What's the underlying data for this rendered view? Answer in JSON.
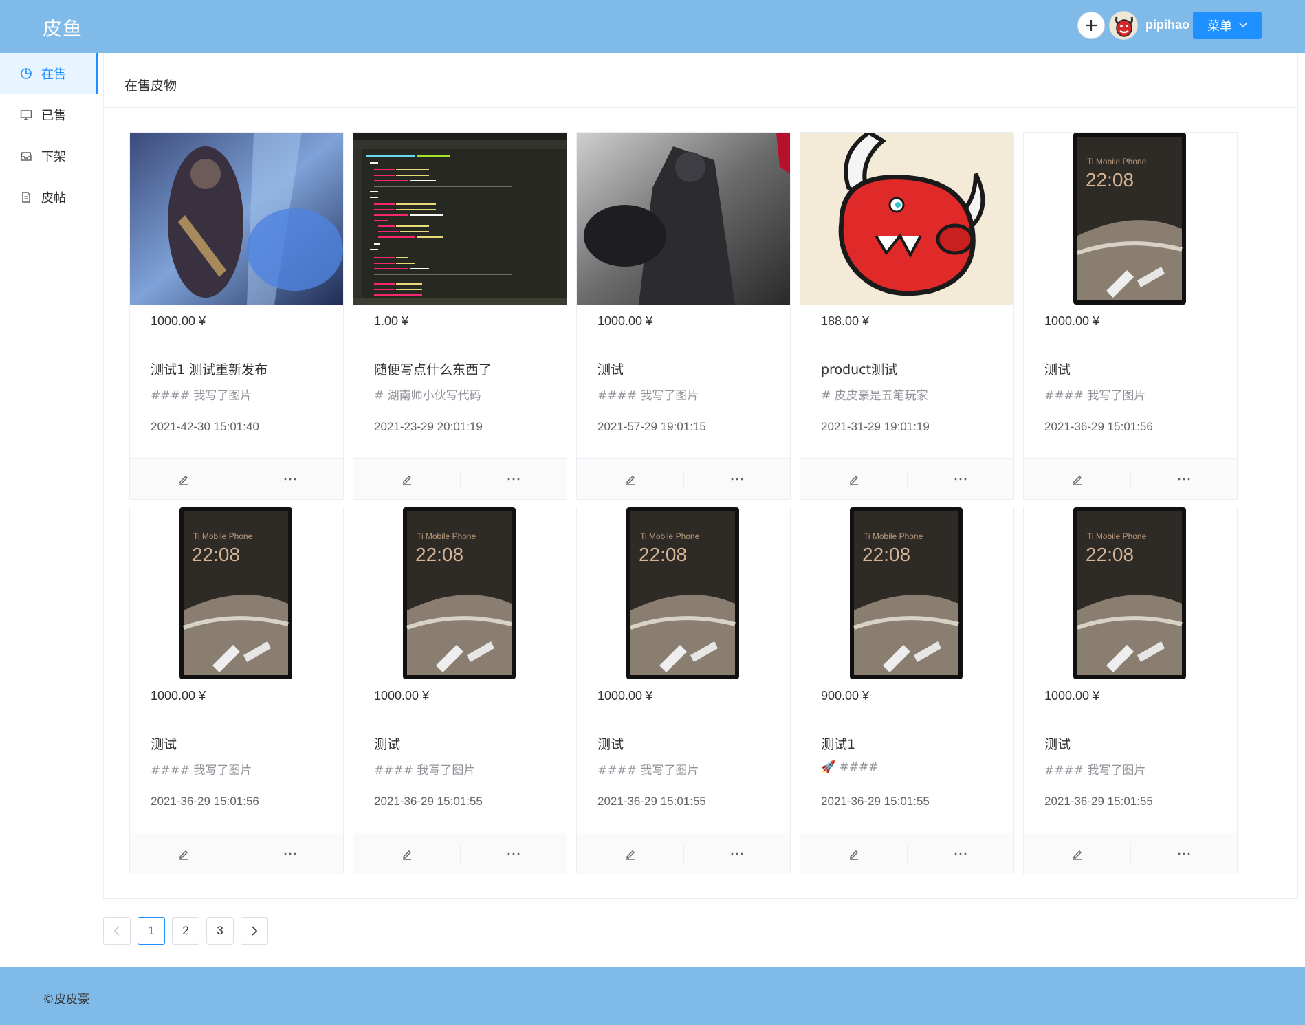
{
  "app": {
    "logo": "皮鱼"
  },
  "header": {
    "username": "pipihao",
    "menu_label": "菜单",
    "add_icon": "plus-icon",
    "avatar_icon": "bull-avatar"
  },
  "sidebar": {
    "items": [
      {
        "label": "在售",
        "icon": "pie-chart-icon",
        "active": true
      },
      {
        "label": "已售",
        "icon": "monitor-icon",
        "active": false
      },
      {
        "label": "下架",
        "icon": "inbox-icon",
        "active": false
      },
      {
        "label": "皮帖",
        "icon": "document-icon",
        "active": false
      }
    ]
  },
  "main": {
    "title": "在售皮物",
    "cards": [
      {
        "image": "game-warrior-blue",
        "price": "1000.00 ¥",
        "title": "测试1 测试重新发布",
        "desc": "#### 我写了图片",
        "time": "2021-42-30 15:01:40"
      },
      {
        "image": "code-editor",
        "price": "1.00 ¥",
        "title": "随便写点什么东西了",
        "desc": "# 湖南帅小伙写代码",
        "time": "2021-23-29 20:01:19"
      },
      {
        "image": "game-warrior-dark",
        "price": "1000.00 ¥",
        "title": "测试",
        "desc": "#### 我写了图片",
        "time": "2021-57-29 19:01:15"
      },
      {
        "image": "bull-logo",
        "price": "188.00 ¥",
        "title": "product测试",
        "desc": "# 皮皮豪是五笔玩家",
        "time": "2021-31-29 19:01:19"
      },
      {
        "image": "phone",
        "price": "1000.00 ¥",
        "title": "测试",
        "desc": "#### 我写了图片",
        "time": "2021-36-29 15:01:56"
      },
      {
        "image": "phone",
        "price": "1000.00 ¥",
        "title": "测试",
        "desc": "#### 我写了图片",
        "time": "2021-36-29 15:01:56"
      },
      {
        "image": "phone",
        "price": "1000.00 ¥",
        "title": "测试",
        "desc": "#### 我写了图片",
        "time": "2021-36-29 15:01:55"
      },
      {
        "image": "phone",
        "price": "1000.00 ¥",
        "title": "测试",
        "desc": "#### 我写了图片",
        "time": "2021-36-29 15:01:55"
      },
      {
        "image": "phone",
        "price": "900.00 ¥",
        "title": "测试1",
        "desc": "🚀 ####",
        "time": "2021-36-29 15:01:55"
      },
      {
        "image": "phone",
        "price": "1000.00 ¥",
        "title": "测试",
        "desc": "#### 我写了图片",
        "time": "2021-36-29 15:01:55"
      }
    ],
    "phone_screen": {
      "brand": "Ti Mobile Phone",
      "clock": "22:08"
    }
  },
  "pagination": {
    "prev_icon": "chevron-left-icon",
    "pages": [
      "1",
      "2",
      "3"
    ],
    "current": "1",
    "next_icon": "chevron-right-icon"
  },
  "footer": {
    "copyright": "©皮皮豪"
  },
  "colors": {
    "header_bg": "#7fbae8",
    "accent": "#1e90ff",
    "sidebar_active_bg": "#e8f4ff"
  }
}
